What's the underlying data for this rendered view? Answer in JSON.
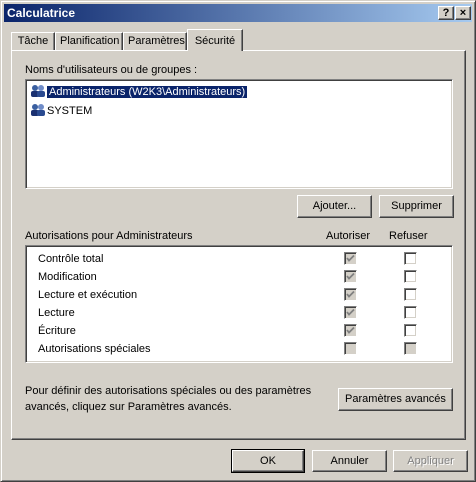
{
  "window": {
    "title": "Calculatrice",
    "help_label": "?",
    "close_label": "×"
  },
  "tabs": [
    "Tâche",
    "Planification",
    "Paramètres",
    "Sécurité"
  ],
  "active_tab": "Sécurité",
  "users": {
    "label": "Noms d'utilisateurs ou de groupes :",
    "items": [
      {
        "name": "Administrateurs (W2K3\\Administrateurs)",
        "selected": true
      },
      {
        "name": "SYSTEM",
        "selected": false
      }
    ]
  },
  "buttons": {
    "add": "Ajouter...",
    "remove": "Supprimer",
    "advanced": "Paramètres avancés",
    "ok": "OK",
    "cancel": "Annuler",
    "apply": "Appliquer"
  },
  "permissions": {
    "header": "Autorisations pour Administrateurs",
    "allow_header": "Autoriser",
    "deny_header": "Refuser",
    "rows": [
      {
        "name": "Contrôle total",
        "allow": true,
        "allow_inherited": true,
        "deny": false,
        "deny_disabled": false
      },
      {
        "name": "Modification",
        "allow": true,
        "allow_inherited": true,
        "deny": false,
        "deny_disabled": false
      },
      {
        "name": "Lecture et exécution",
        "allow": true,
        "allow_inherited": true,
        "deny": false,
        "deny_disabled": false
      },
      {
        "name": "Lecture",
        "allow": true,
        "allow_inherited": true,
        "deny": false,
        "deny_disabled": false
      },
      {
        "name": "Écriture",
        "allow": true,
        "allow_inherited": true,
        "deny": false,
        "deny_disabled": false
      },
      {
        "name": "Autorisations spéciales",
        "allow": false,
        "allow_inherited": true,
        "deny": false,
        "deny_disabled": true
      }
    ]
  },
  "advanced_text": {
    "line1": "Pour définir des autorisations spéciales ou des paramètres",
    "line2": "avancés, cliquez sur Paramètres avancés."
  },
  "colors": {
    "titlebar_start": "#0a246a",
    "titlebar_end": "#a6caf0",
    "selection": "#0a246a",
    "face": "#d4d0c8"
  }
}
